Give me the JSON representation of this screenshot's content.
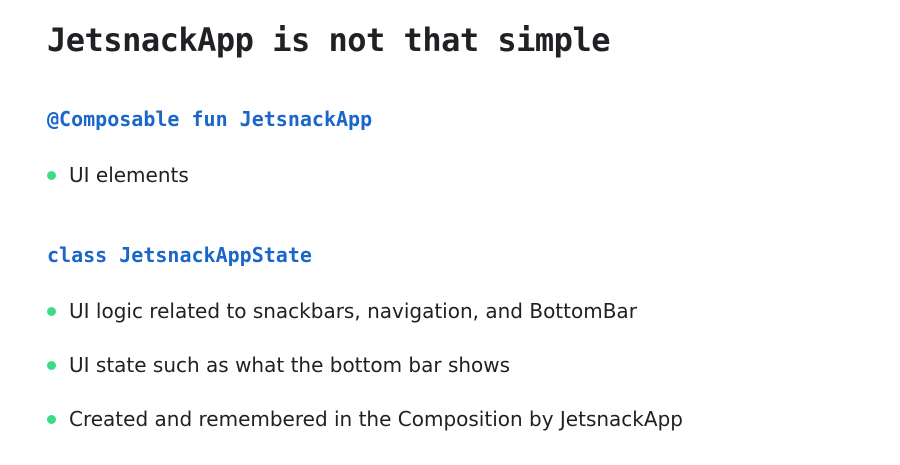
{
  "title": "JetsnackApp is not that simple",
  "sections": [
    {
      "code": "@Composable fun JetsnackApp",
      "bullets": [
        "UI elements"
      ]
    },
    {
      "code": "class JetsnackAppState",
      "bullets": [
        "UI logic related to snackbars, navigation, and BottomBar",
        "UI state such as what the bottom bar shows",
        "Created and remembered in the Composition by JetsnackApp"
      ]
    }
  ],
  "colors": {
    "code": "#1a66c9",
    "bullet": "#3ddc84",
    "text": "#202124"
  }
}
